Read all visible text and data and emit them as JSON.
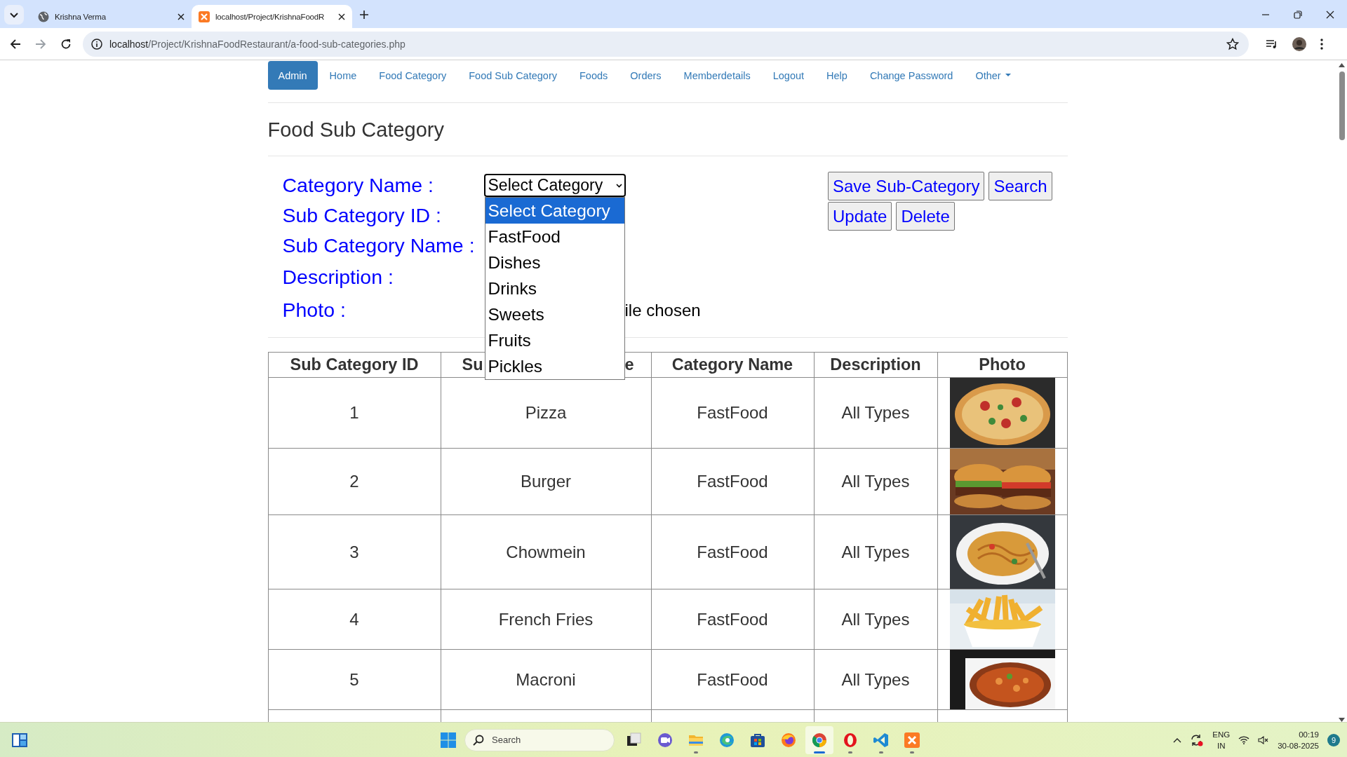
{
  "browser": {
    "tabs": [
      {
        "title": "Krishna Verma",
        "kind": "globe",
        "selected": false
      },
      {
        "title": "localhost/Project/KrishnaFoodR",
        "kind": "xampp",
        "selected": true
      }
    ],
    "url": {
      "host": "localhost",
      "path": "/Project/KrishnaFoodRestaurant/a-food-sub-categories.php"
    }
  },
  "nav": [
    {
      "label": "Admin",
      "kind": "link",
      "selected": true
    },
    {
      "label": "Home",
      "kind": "link",
      "selected": false
    },
    {
      "label": "Food Category",
      "kind": "link",
      "selected": false
    },
    {
      "label": "Food Sub Category",
      "kind": "link",
      "selected": false
    },
    {
      "label": "Foods",
      "kind": "link",
      "selected": false
    },
    {
      "label": "Orders",
      "kind": "link",
      "selected": false
    },
    {
      "label": "Memberdetails",
      "kind": "link",
      "selected": false
    },
    {
      "label": "Logout",
      "kind": "link",
      "selected": false
    },
    {
      "label": "Help",
      "kind": "link",
      "selected": false
    },
    {
      "label": "Change Password",
      "kind": "link",
      "selected": false
    },
    {
      "label": "Other",
      "kind": "dropdown",
      "selected": false
    }
  ],
  "heading": "Food Sub Category",
  "form": {
    "fields": [
      {
        "label": "Category Name :",
        "kind": "select"
      },
      {
        "label": "Sub Category ID :",
        "kind": "hidden"
      },
      {
        "label": "Sub Category Name :",
        "kind": "hidden"
      },
      {
        "label": "Description :",
        "kind": "hidden"
      },
      {
        "label": "Photo :",
        "kind": "file"
      }
    ],
    "select": {
      "value": "Select Category",
      "expanded": true,
      "options": [
        {
          "label": "Select Category",
          "selected": true
        },
        {
          "label": "FastFood",
          "selected": false
        },
        {
          "label": "Dishes",
          "selected": false
        },
        {
          "label": "Drinks",
          "selected": false
        },
        {
          "label": "Sweets",
          "selected": false
        },
        {
          "label": "Fruits",
          "selected": false
        },
        {
          "label": "Pickles",
          "selected": false
        }
      ]
    },
    "file_status": "ile chosen",
    "buttons": [
      [
        "Save Sub-Category",
        "Search"
      ],
      [
        "Update",
        "Delete"
      ]
    ]
  },
  "table": {
    "columns": [
      {
        "parts": [
          "Sub Category ID"
        ]
      },
      {
        "parts": [
          "Su",
          "e"
        ]
      },
      {
        "parts": [
          "Category Name"
        ]
      },
      {
        "parts": [
          "Description"
        ]
      },
      {
        "parts": [
          "Photo"
        ]
      }
    ],
    "rows": [
      {
        "id": "1",
        "name": "Pizza",
        "category": "FastFood",
        "description": "All Types"
      },
      {
        "id": "2",
        "name": "Burger",
        "category": "FastFood",
        "description": "All Types"
      },
      {
        "id": "3",
        "name": "Chowmein",
        "category": "FastFood",
        "description": "All Types"
      },
      {
        "id": "4",
        "name": "French Fries",
        "category": "FastFood",
        "description": "All Types"
      },
      {
        "id": "5",
        "name": "Macroni",
        "category": "FastFood",
        "description": "All Types"
      }
    ]
  },
  "taskbar": {
    "search_placeholder": "Search",
    "apps": [
      {
        "kind": "taskview",
        "running": false,
        "selected": false
      },
      {
        "kind": "meet",
        "running": false,
        "selected": false
      },
      {
        "kind": "explorer",
        "running": true,
        "selected": false
      },
      {
        "kind": "edge",
        "running": false,
        "selected": false
      },
      {
        "kind": "store",
        "running": false,
        "selected": false
      },
      {
        "kind": "firefox",
        "running": false,
        "selected": false
      },
      {
        "kind": "chrome",
        "running": true,
        "selected": true
      },
      {
        "kind": "opera",
        "running": true,
        "selected": false
      },
      {
        "kind": "vscode",
        "running": true,
        "selected": false
      },
      {
        "kind": "xampp",
        "running": true,
        "selected": false
      }
    ],
    "language": "ENG",
    "region": "IN",
    "time": "00:19",
    "date": "30-08-2025",
    "notifications": "9"
  }
}
